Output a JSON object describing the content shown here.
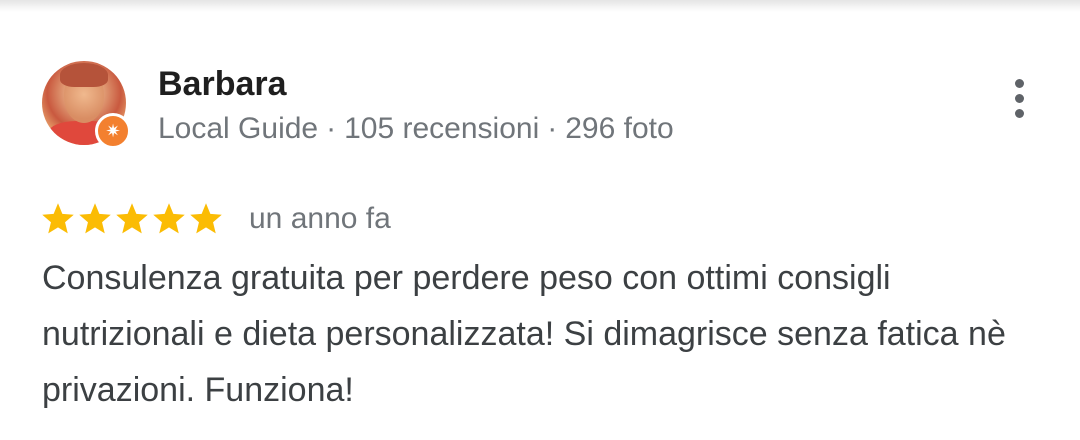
{
  "review": {
    "author": {
      "name": "Barbara",
      "badge_icon": "local-guide-star-icon",
      "level": "Local Guide",
      "separator": "·",
      "reviews_count": "105 recensioni",
      "photos_count": "296 foto"
    },
    "rating": {
      "stars": 5,
      "max_stars": 5,
      "star_color": "#fbbc04"
    },
    "date": "un anno fa",
    "text": "Consulenza gratuita per perdere peso con ottimi consigli nutrizionali e dieta personalizzata! Si dimagrisce senza fatica nè privazioni. Funziona!",
    "more_icon": "more-vertical-icon"
  },
  "colors": {
    "name": "#1f1f1f",
    "meta": "#70757a",
    "body_text": "#3c4043",
    "badge": "#f3802f"
  }
}
